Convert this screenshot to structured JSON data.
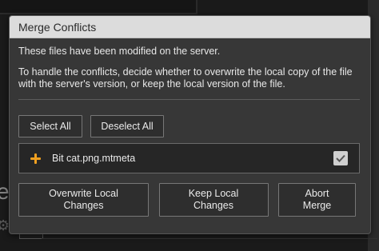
{
  "dialog": {
    "title": "Merge Conflicts",
    "message_line1": "These files have been modified on the server.",
    "message_line2": "To handle the conflicts, decide whether to overwrite the local copy of the file with the server's version, or keep the local version of the file.",
    "select_all_label": "Select All",
    "deselect_all_label": "Deselect All",
    "files": [
      {
        "name": "Bit cat.png.mtmeta",
        "status_icon": "plus-icon",
        "checked": true
      }
    ],
    "actions": {
      "overwrite_label": "Overwrite Local\nChanges",
      "keep_label": "Keep Local\nChanges",
      "abort_label": "Abort\nMerge"
    }
  },
  "background": {
    "left_glyph": "e",
    "left_icon": "gear-icon"
  },
  "colors": {
    "titlebar": "#dcdcdc",
    "dialog_body": "#373737",
    "accent_plus": "#f0a020",
    "checkbox": "#cfcfcf"
  }
}
